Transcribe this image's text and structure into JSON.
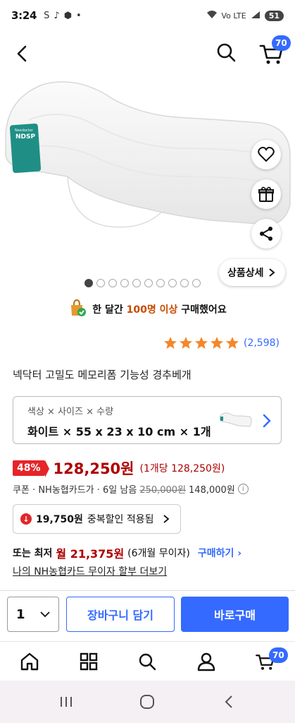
{
  "status_bar": {
    "time": "3:24",
    "left_icons": [
      "S",
      "tiktok-icon",
      "shield-icon",
      "•"
    ],
    "signal_text": "Vo LTE",
    "battery": "51"
  },
  "header": {
    "cart_count": "70"
  },
  "product_image": {
    "brand_tag": "NDSP",
    "brand_small": "Nexdoctor"
  },
  "detail_button": {
    "label": "상품상세"
  },
  "pagination": {
    "total": 10,
    "active": 0
  },
  "purchase_note": {
    "prefix": "한 달간",
    "highlight": "100명 이상",
    "suffix": "구매했어요"
  },
  "rating": {
    "stars": 5,
    "count": "(2,598)"
  },
  "product_title": "넥닥터 고밀도 메모리폼 기능성 경추베개",
  "option": {
    "label": "색상 × 사이즈 × 수량",
    "value": "화이트 × 55 x 23 x 10 cm × 1개"
  },
  "price": {
    "discount": "48%",
    "sale": "128,250원",
    "unit": "(1개당 128,250원)",
    "coupon_line": "쿠폰 · NH농협카드가 · 6일 남음",
    "original": "250,000원",
    "card_price": "148,000원"
  },
  "coupon": {
    "amount": "19,750원",
    "text": "중복할인 적용됨"
  },
  "installment": {
    "prefix": "또는 최저",
    "monthly": "월 21,375원",
    "terms": "(6개월 무이자)",
    "buy_link": "구매하기"
  },
  "card_link": "나의 NH농협카드 무이자 할부 더보기",
  "purchase_bar": {
    "quantity": "1",
    "add_to_cart": "장바구니 담기",
    "buy_now": "바로구매"
  },
  "tab_bar": {
    "items": [
      "home-icon",
      "category-icon",
      "search-icon",
      "user-icon",
      "cart-icon"
    ],
    "cart_count": "70"
  },
  "colors": {
    "accent": "#346aff",
    "price_red": "#ae0000",
    "badge_red": "#e52528",
    "star": "#f5872a"
  }
}
